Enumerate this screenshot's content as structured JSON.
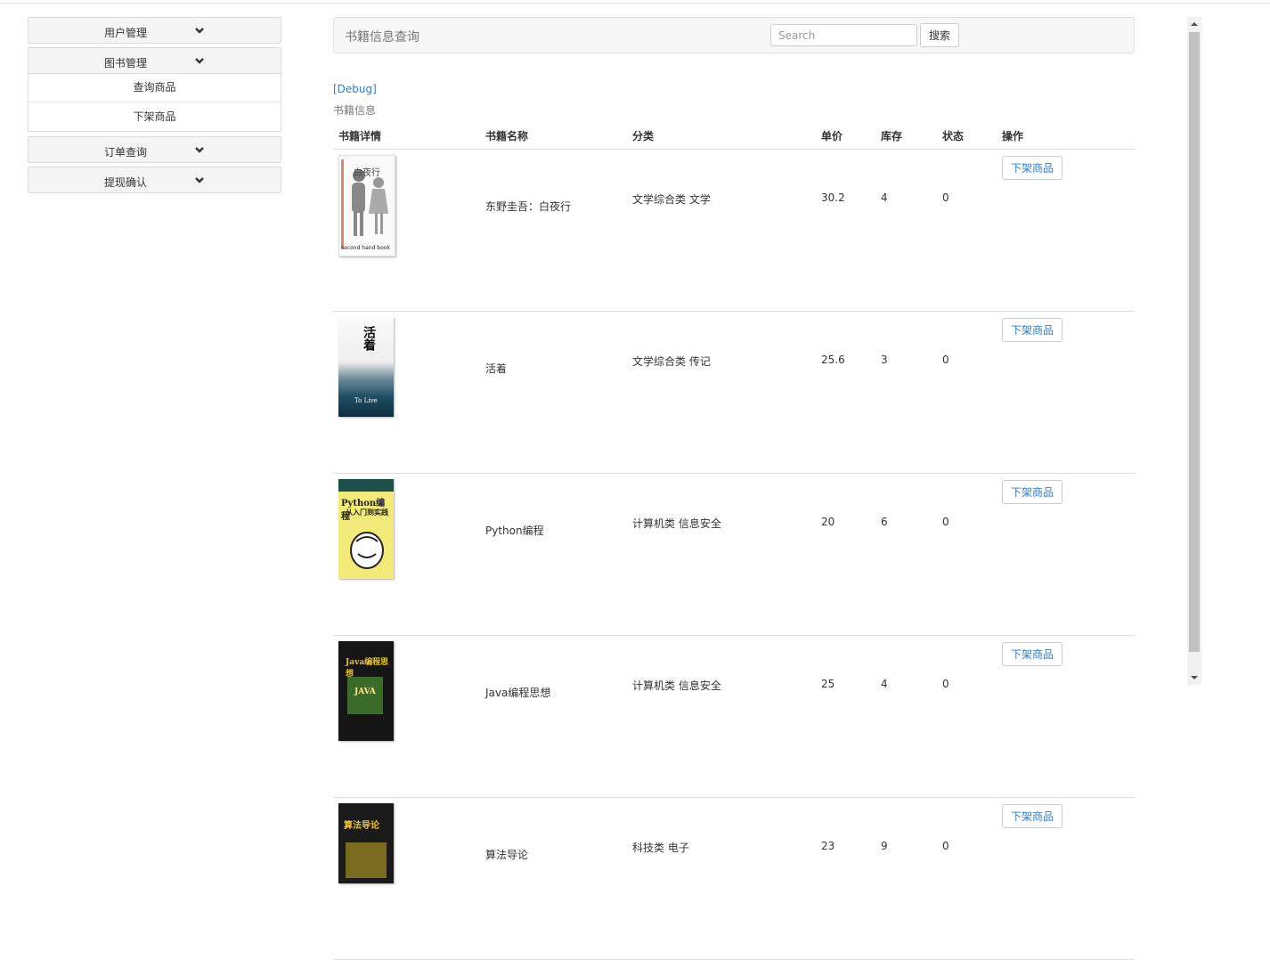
{
  "sidebar": {
    "menus": [
      {
        "label": "用户管理"
      },
      {
        "label": "图书管理",
        "items": [
          "查询商品",
          "下架商品"
        ]
      },
      {
        "label": "订单查询"
      },
      {
        "label": "提现确认"
      }
    ]
  },
  "topbar": {
    "brand": "书籍信息查询",
    "search_placeholder": "Search",
    "search_button": "搜索"
  },
  "debug_link": "[Debug]",
  "table": {
    "caption": "书籍信息",
    "headers": [
      "书籍详情",
      "书籍名称",
      "分类",
      "单价",
      "库存",
      "状态",
      "操作"
    ],
    "rows": [
      {
        "cover": "白夜行",
        "cover_sub": "second hand book",
        "name": "东野圭吾：白夜行",
        "category": "文学综合类 文学",
        "price": "30.2",
        "stock": "4",
        "status": "0",
        "action": "下架商品"
      },
      {
        "cover": "活着",
        "cover_sub": "To Live",
        "name": "活着",
        "category": "文学综合类 传记",
        "price": "25.6",
        "stock": "3",
        "status": "0",
        "action": "下架商品"
      },
      {
        "cover": "Python编程",
        "cover_sub": "从入门到实践",
        "name": "Python编程",
        "category": "计算机类 信息安全",
        "price": "20",
        "stock": "6",
        "status": "0",
        "action": "下架商品"
      },
      {
        "cover": "Java编程思想",
        "cover_sub": "JAVA",
        "name": "Java编程思想",
        "category": "计算机类 信息安全",
        "price": "25",
        "stock": "4",
        "status": "0",
        "action": "下架商品"
      },
      {
        "cover": "算法导论",
        "cover_sub": "",
        "name": "算法导论",
        "category": "科技类 电子",
        "price": "23",
        "stock": "9",
        "status": "0",
        "action": "下架商品"
      }
    ]
  },
  "colors": {
    "link": "#337ab7",
    "sidebar_bg": "#f5f5f5",
    "border": "#dddddd"
  }
}
